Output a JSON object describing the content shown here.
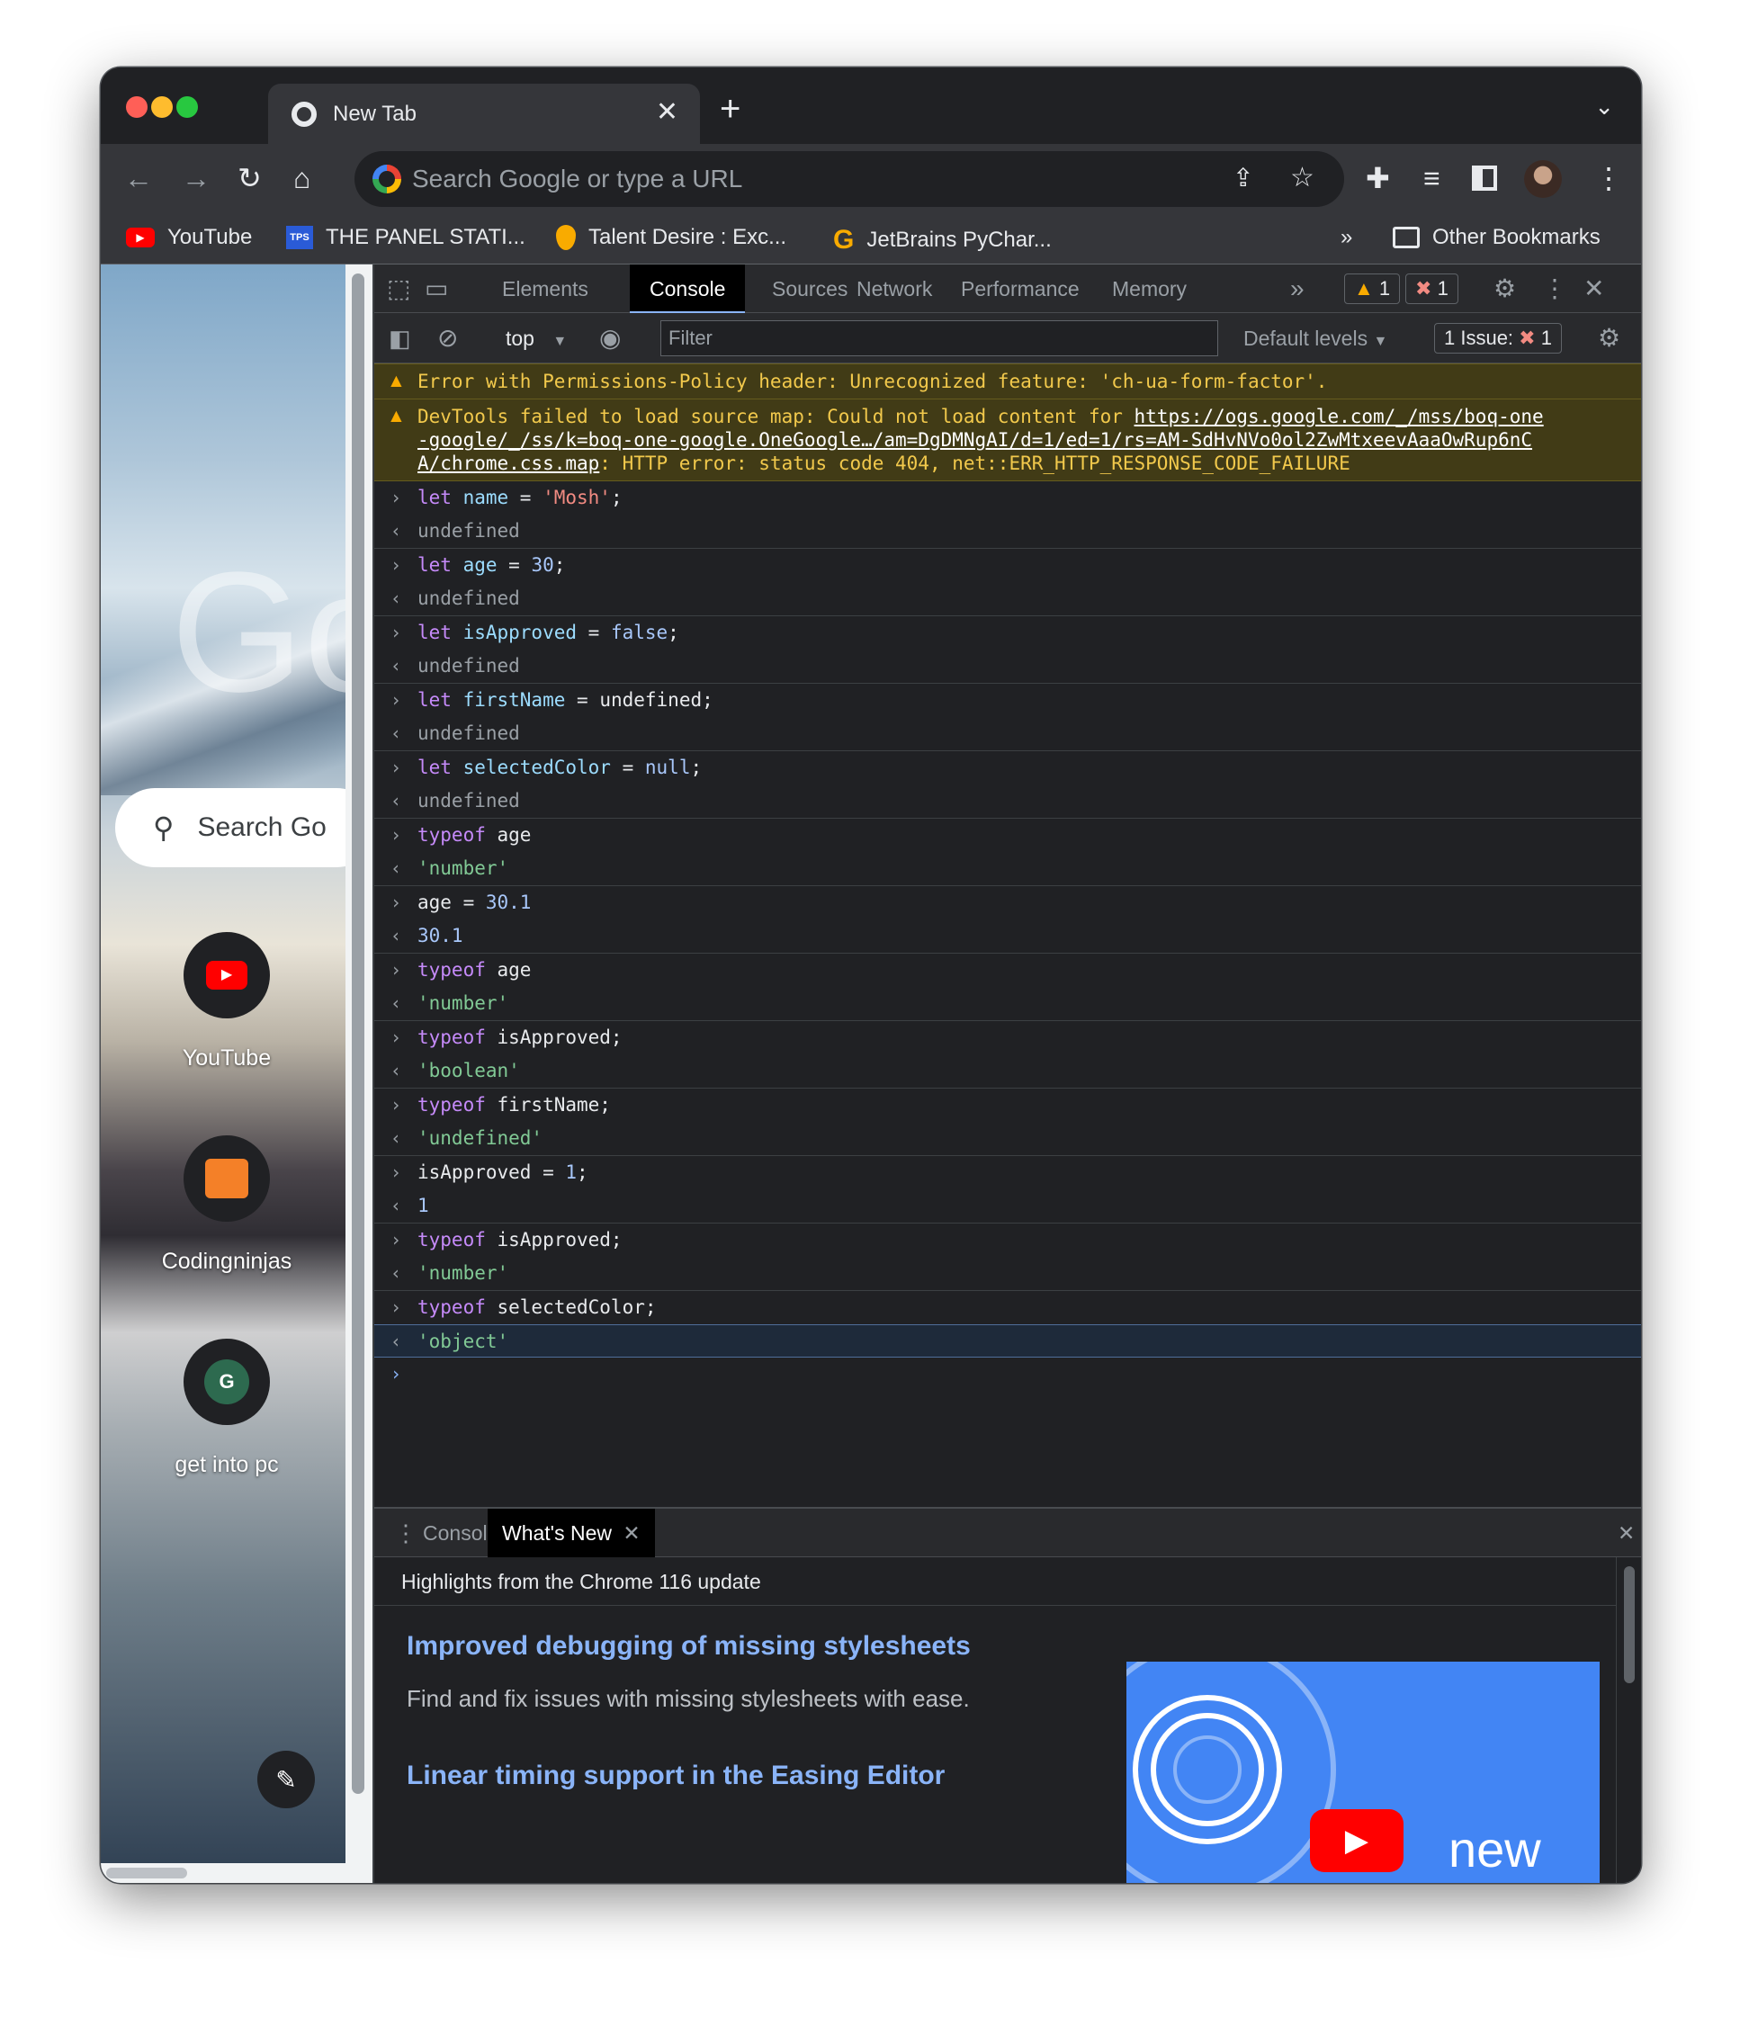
{
  "browser": {
    "tab_title": "New Tab",
    "tab_close": "✕",
    "new_tab": "+",
    "omnibox_placeholder": "Search Google or type a URL"
  },
  "bookmarks": [
    {
      "label": "YouTube",
      "icon": "youtube-icon"
    },
    {
      "label": "THE PANEL STATI...",
      "icon": "tps-icon"
    },
    {
      "label": "Talent Desire : Exc...",
      "icon": "pin-icon"
    },
    {
      "label": "JetBrains PyChar...",
      "icon": "g-icon"
    },
    {
      "label": "Other Bookmarks",
      "icon": "folder-icon"
    }
  ],
  "bookmarks_overflow": "»",
  "ntp": {
    "logo_text": "Go",
    "search_placeholder": "Search Go",
    "shortcuts": [
      {
        "label": "YouTube"
      },
      {
        "label": "Codingninjas"
      },
      {
        "label": "get into pc",
        "letter": "G"
      }
    ]
  },
  "devtools": {
    "tabs": [
      "Elements",
      "Console",
      "Sources",
      "Network",
      "Performance",
      "Memory"
    ],
    "active_tab": "Console",
    "more": "»",
    "warn_count": "1",
    "error_count": "1",
    "context": "top",
    "filter_placeholder": "Filter",
    "levels": "Default levels",
    "issues_label": "1 Issue:",
    "issues_count": "1"
  },
  "console": {
    "warning1": "Error with Permissions-Policy header: Unrecognized feature: 'ch-ua-form-factor'.",
    "warning2_prefix": "DevTools failed to load source map: Could not load content for ",
    "warning2_link_1": "https://ogs.google.com/_/mss/boq-one",
    "warning2_link_2": "-google/_/ss/k=boq-one-google.OneGoogle…/am=DgDMNgAI/d=1/ed=1/rs=AM-SdHvNVo0ol2ZwMtxeevAaaOwRup6nC",
    "warning2_link_3": "A/chrome.css.map",
    "warning2_suffix": ": HTTP error: status code 404, net::ERR_HTTP_RESPONSE_CODE_FAILURE",
    "entries": [
      {
        "in": [
          "let ",
          "name",
          " = ",
          "'Mosh'",
          ";"
        ],
        "out": "undefined"
      },
      {
        "in": [
          "let ",
          "age",
          " = ",
          "30",
          ";"
        ],
        "out": "undefined"
      },
      {
        "in": [
          "let ",
          "isApproved",
          " = ",
          "false",
          ";"
        ],
        "out": "undefined"
      },
      {
        "in": [
          "let ",
          "firstName",
          " = ",
          "undefined",
          ";"
        ],
        "out": "undefined"
      },
      {
        "in": [
          "let ",
          "selectedColor",
          " = ",
          "null",
          ";"
        ],
        "out": "undefined"
      },
      {
        "in": [
          "typeof",
          " age"
        ],
        "out": "'number'"
      },
      {
        "in": [
          "age = ",
          "30.1"
        ],
        "out": "30.1"
      },
      {
        "in": [
          "typeof",
          " age"
        ],
        "out": "'number'"
      },
      {
        "in": [
          "typeof",
          " isApproved;"
        ],
        "out": "'boolean'"
      },
      {
        "in": [
          "typeof",
          " firstName;"
        ],
        "out": "'undefined'"
      },
      {
        "in": [
          "isApproved = ",
          "1",
          ";"
        ],
        "out": "1"
      },
      {
        "in": [
          "typeof",
          " isApproved;"
        ],
        "out": "'number'"
      },
      {
        "in": [
          "typeof",
          " selectedColor;"
        ],
        "out": "'object'"
      }
    ]
  },
  "drawer": {
    "tabs": [
      "Console",
      "What's New"
    ],
    "active_tab": "What's New",
    "header": "Highlights from the Chrome 116 update",
    "heading1": "Improved debugging of missing stylesheets",
    "para1": "Find and fix issues with missing stylesheets with ease.",
    "heading2": "Linear timing support in the Easing Editor",
    "image_text": "new"
  }
}
